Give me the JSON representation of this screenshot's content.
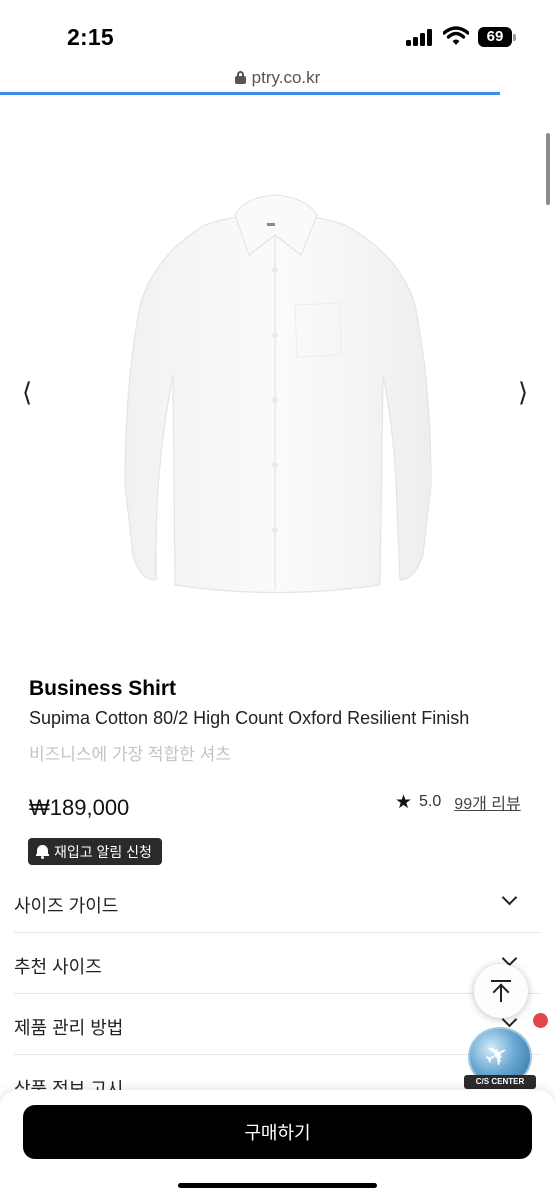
{
  "status_bar": {
    "time": "2:15",
    "battery": "69",
    "icons": [
      "cellular-signal-icon",
      "wifi-icon",
      "battery-icon"
    ]
  },
  "browser": {
    "url": "ptry.co.kr",
    "url_icon": "lock-icon",
    "load_progress": 0.9,
    "accent_color": "#3b8ef0"
  },
  "carousel": {
    "prev_arrow": "⟨",
    "next_arrow": "⟩",
    "image": "white-oxford-shirt"
  },
  "product": {
    "name": "Business Shirt",
    "subtitle": "Supima Cotton 80/2 High Count Oxford Resilient Finish",
    "description": "비즈니스에 가장 적합한 셔츠",
    "price": "₩189,000",
    "rating_icon": "★",
    "rating": "5.0",
    "reviews": "99개 리뷰",
    "restock_button": "재입고 알림 신청"
  },
  "accordion": [
    {
      "label": "사이즈 가이드"
    },
    {
      "label": "추천 사이즈"
    },
    {
      "label": "제품 관리 방법"
    },
    {
      "label": "상품 정보 고시"
    }
  ],
  "floating": {
    "to_top_icon": "arrow-up-icon",
    "cs_label": "C/S CENTER",
    "cs_icon": "✈",
    "notification_color": "#e0474d"
  },
  "bottom_bar": {
    "buy_label": "구매하기"
  }
}
